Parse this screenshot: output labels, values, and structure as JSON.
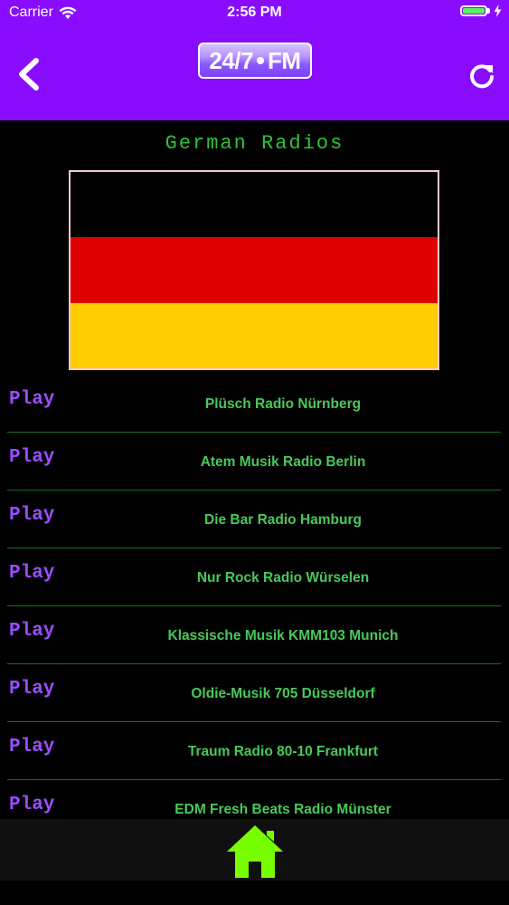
{
  "status_bar": {
    "carrier": "Carrier",
    "time": "2:56 PM",
    "battery_level": 1.0
  },
  "header": {
    "background_color": "#8a0cff",
    "logo_left": "24/7",
    "logo_right": "FM",
    "back_icon": "chevron-left-icon",
    "refresh_icon": "refresh-icon"
  },
  "section": {
    "title": "German Radios"
  },
  "flag": {
    "colors": [
      "#000000",
      "#dd0000",
      "#ffcc00"
    ]
  },
  "stations": [
    {
      "action": "Play",
      "name": "Plüsch Radio Nürnberg"
    },
    {
      "action": "Play",
      "name": "Atem Musik Radio Berlin"
    },
    {
      "action": "Play",
      "name": "Die Bar Radio Hamburg"
    },
    {
      "action": "Play",
      "name": "Nur Rock Radio Würselen"
    },
    {
      "action": "Play",
      "name": "Klassische Musik KMM103 Munich"
    },
    {
      "action": "Play",
      "name": "Oldie-Musik 705 Düsseldorf"
    },
    {
      "action": "Play",
      "name": "Traum Radio 80-10 Frankfurt"
    },
    {
      "action": "Play",
      "name": "EDM Fresh Beats Radio Münster"
    }
  ],
  "tabbar": {
    "home_icon": "home-icon",
    "home_color": "#77ff00"
  }
}
